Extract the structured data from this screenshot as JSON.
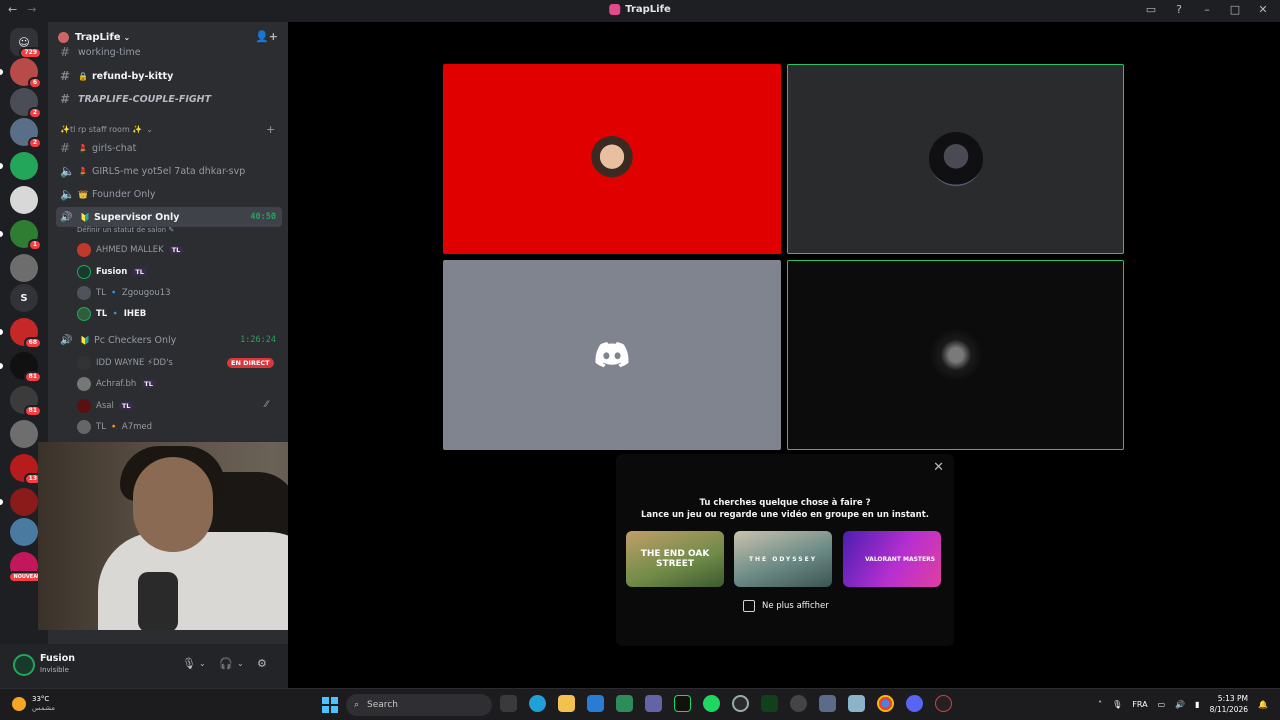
{
  "window": {
    "title": "TrapLife"
  },
  "rail": {
    "home_badge": "729",
    "servers": [
      {
        "name": "server-1",
        "badge": "6",
        "color": "#b84a4a"
      },
      {
        "name": "server-2",
        "badge": "2",
        "color": "#4a4d55"
      },
      {
        "name": "server-3",
        "badge": "2",
        "color": "#5a6e88"
      },
      {
        "name": "server-4",
        "badge": "",
        "color": "#23a55a"
      },
      {
        "name": "server-traplife",
        "badge": "",
        "color": "#d8d8d8"
      },
      {
        "name": "server-6",
        "badge": "1",
        "color": "#2e7d32"
      },
      {
        "name": "server-7",
        "badge": "",
        "color": "#6d6d6d"
      },
      {
        "name": "server-s",
        "badge": "",
        "color": "#313338",
        "letter": "S"
      },
      {
        "name": "server-9",
        "badge": "68",
        "color": "#c62828"
      },
      {
        "name": "server-clutch",
        "badge": "81",
        "color": "#111111"
      },
      {
        "name": "server-11",
        "badge": "81",
        "color": "#3b3b3b"
      },
      {
        "name": "server-12",
        "badge": "",
        "color": "#6e6e6e"
      },
      {
        "name": "server-13",
        "badge": "13",
        "color": "#b71c1c"
      },
      {
        "name": "server-criminal",
        "badge": "",
        "color": "#8b1a1a"
      },
      {
        "name": "server-15",
        "badge": "",
        "color": "#4a7aa0"
      },
      {
        "name": "server-16",
        "badge": "NOUVEAU",
        "color": "#c2185b"
      }
    ]
  },
  "sidebar": {
    "guild_name": "TrapLife",
    "channels_top": [
      {
        "label": "working-time",
        "style": "partial"
      },
      {
        "label": "refund-by-kitty",
        "style": "bold"
      },
      {
        "label": "TRAPLIFE-COUPLE-FIGHT",
        "style": "italic"
      }
    ],
    "category": "✨tl rp staff room ✨",
    "channels": [
      {
        "label": "girls-chat",
        "type": "text",
        "emoji": "💄"
      },
      {
        "label": "GIRLS-me yot5el 7ata dhkar-svp",
        "type": "voice",
        "emoji": "💄"
      },
      {
        "label": "Founder Only",
        "type": "voice",
        "emoji": "👑"
      }
    ],
    "active_voice": {
      "label": "Supervisor Only",
      "emoji": "🔰",
      "timer": "40:50",
      "status_hint": "Définir un statut de salon"
    },
    "active_members": [
      {
        "name": "AHMED MALLEK",
        "tag": "TL",
        "color": "#c0392b"
      },
      {
        "name": "Fusion",
        "tag": "TL",
        "color": "#18392b",
        "me": true
      },
      {
        "name": "TL 🔹 Zgougou13",
        "tag": "",
        "color": "#4f545c"
      },
      {
        "name": "TL 🔹 IHEB",
        "tag": "",
        "color": "#2e5e3e",
        "me": true
      }
    ],
    "second_voice": {
      "label": "Pc Checkers Only",
      "emoji": "🔰",
      "timer": "1:26:24"
    },
    "second_members": [
      {
        "name": "IDD WAYNE ⚡DD's",
        "tag": "",
        "color": "#333",
        "live": "EN DIRECT"
      },
      {
        "name": "Achraf.bh",
        "tag": "TL",
        "color": "#777"
      },
      {
        "name": "Asal",
        "tag": "TL",
        "color": "#5a1010"
      },
      {
        "name": "TL 🔸 A7med",
        "tag": "",
        "color": "#666"
      }
    ]
  },
  "user": {
    "name": "Fusion",
    "status": "Invisible"
  },
  "activity_prompt": {
    "line1": "Tu cherches quelque chose à faire ?",
    "line2": "Lance un jeu ou regarde une vidéo en groupe en un instant.",
    "cards": [
      "THE END OAK STREET",
      "THE ODYSSEY",
      "VALORANT MASTERS"
    ],
    "checkbox_label": "Ne plus afficher"
  },
  "taskbar": {
    "temperature": "33°C",
    "weather_label": "مشمس",
    "search_placeholder": "Search",
    "language": "FRA",
    "time": "5:13 PM",
    "date": "8/11/2026"
  }
}
